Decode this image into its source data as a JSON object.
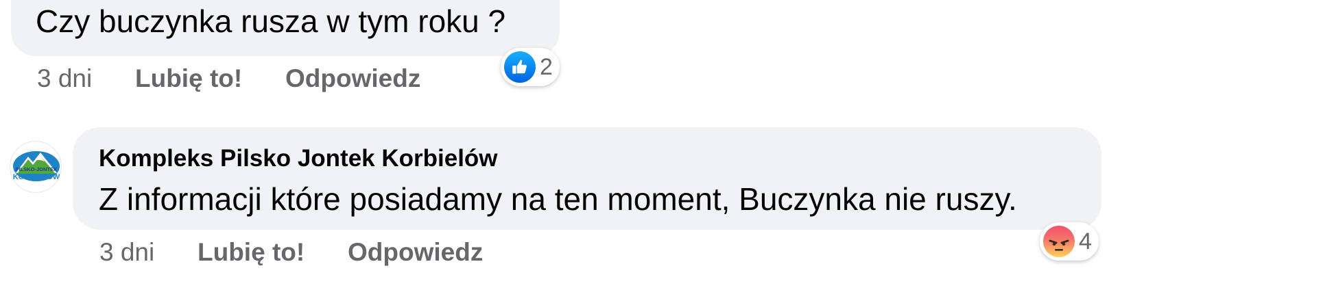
{
  "comments": [
    {
      "text": "Czy buczynka rusza w tym roku ?",
      "time": "3 dni",
      "like_label": "Lubię to!",
      "reply_label": "Odpowiedz",
      "reaction": {
        "icon": "like-icon",
        "count": "2",
        "color": "#1877f2"
      }
    },
    {
      "author": "Kompleks Pilsko Jontek Korbielów",
      "avatar": {
        "icon": "mountain-logo-icon",
        "logo_top_text": "PILSKO-JONTEK",
        "logo_bottom_text": "KORBIELÓW"
      },
      "text": "Z informacji które posiadamy na ten moment, Buczynka nie ruszy.",
      "time": "3 dni",
      "like_label": "Lubię to!",
      "reply_label": "Odpowiedz",
      "reaction": {
        "icon": "angry-icon",
        "count": "4",
        "color": "#f25268"
      }
    }
  ]
}
